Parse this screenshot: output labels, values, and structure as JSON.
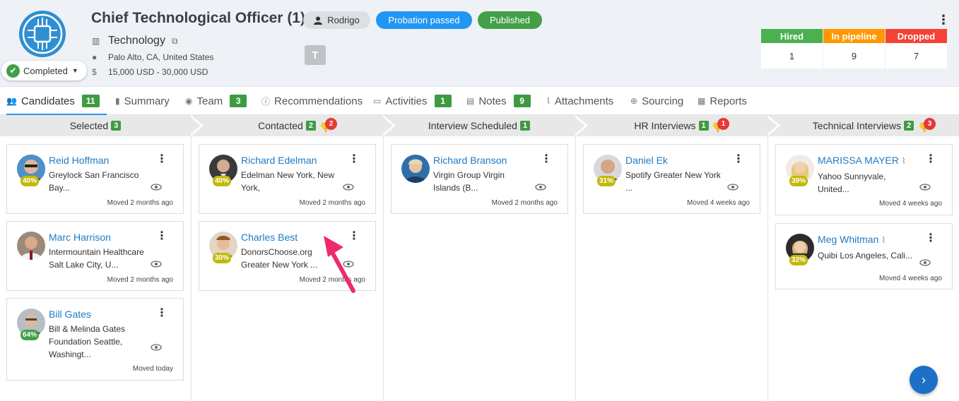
{
  "job": {
    "title": "Chief Technological Officer (1)",
    "owner": "Rodrigo",
    "badge_status": "Probation passed",
    "badge_publish": "Published",
    "department": "Technology",
    "location": "Palo Alto, CA, United States",
    "salary": "15,000 USD - 30,000 USD",
    "status": "Completed",
    "team_avatar": "T"
  },
  "stats": [
    {
      "label": "Hired",
      "value": "1",
      "color": "#4caf50"
    },
    {
      "label": "In pipeline",
      "value": "9",
      "color": "#ff9800"
    },
    {
      "label": "Dropped",
      "value": "7",
      "color": "#f44336"
    }
  ],
  "tabs": [
    {
      "label": "Candidates",
      "count": "11",
      "icon": "people-icon"
    },
    {
      "label": "Summary",
      "icon": "document-icon"
    },
    {
      "label": "Team",
      "count": "3",
      "icon": "user-circle-icon"
    },
    {
      "label": "Recommendations",
      "icon": "info-icon"
    },
    {
      "label": "Activities",
      "count": "1",
      "icon": "calendar-icon"
    },
    {
      "label": "Notes",
      "count": "9",
      "icon": "note-icon"
    },
    {
      "label": "Attachments",
      "icon": "paperclip-icon"
    },
    {
      "label": "Sourcing",
      "icon": "sourcing-icon"
    },
    {
      "label": "Reports",
      "icon": "chart-icon"
    }
  ],
  "stages": [
    {
      "label": "Selected",
      "count": "3"
    },
    {
      "label": "Contacted",
      "count": "2",
      "dropped": "2"
    },
    {
      "label": "Interview Scheduled",
      "count": "1"
    },
    {
      "label": "HR Interviews",
      "count": "1",
      "dropped": "1"
    },
    {
      "label": "Technical Interviews",
      "count": "2",
      "dropped": "3"
    }
  ],
  "cards": {
    "reid": {
      "name": "Reid Hoffman",
      "desc": "Greylock San Francisco Bay...",
      "score": "40%",
      "moved": "Moved 2 months ago"
    },
    "marc": {
      "name": "Marc Harrison",
      "desc": "Intermountain Healthcare Salt Lake City, U...",
      "moved": "Moved 2 months ago"
    },
    "bill": {
      "name": "Bill Gates",
      "desc": "Bill & Melinda Gates Foundation Seattle, Washingt...",
      "score": "64%",
      "moved": "Moved today"
    },
    "richard_e": {
      "name": "Richard Edelman",
      "desc": "Edelman New York, New York,",
      "score": "40%",
      "moved": "Moved 2 months ago"
    },
    "charles": {
      "name": "Charles Best",
      "desc": "DonorsChoose.org Greater New York ...",
      "score": "30%",
      "moved": "Moved 2 months ago"
    },
    "richard_b": {
      "name": "Richard Branson",
      "desc": "Virgin Group Virgin Islands (B...",
      "moved": "Moved 2 months ago"
    },
    "daniel": {
      "name": "Daniel Ek",
      "desc": "Spotify Greater New York ...",
      "score": "31%",
      "moved": "Moved 4 weeks ago"
    },
    "marissa": {
      "name": "MARISSA MAYER",
      "desc": "Yahoo Sunnyvale, United...",
      "score": "39%",
      "moved": "Moved 4 weeks ago"
    },
    "meg": {
      "name": "Meg Whitman",
      "desc": "Quibi Los Angeles, Cali...",
      "score": "32%",
      "moved": "Moved 4 weeks ago"
    }
  },
  "colors": {
    "accent": "#2196f3",
    "count_green": "#3f9b42",
    "link": "#1e7bc4",
    "score_yellow": "#c2b80a",
    "annotation": "#ee2a6e"
  }
}
